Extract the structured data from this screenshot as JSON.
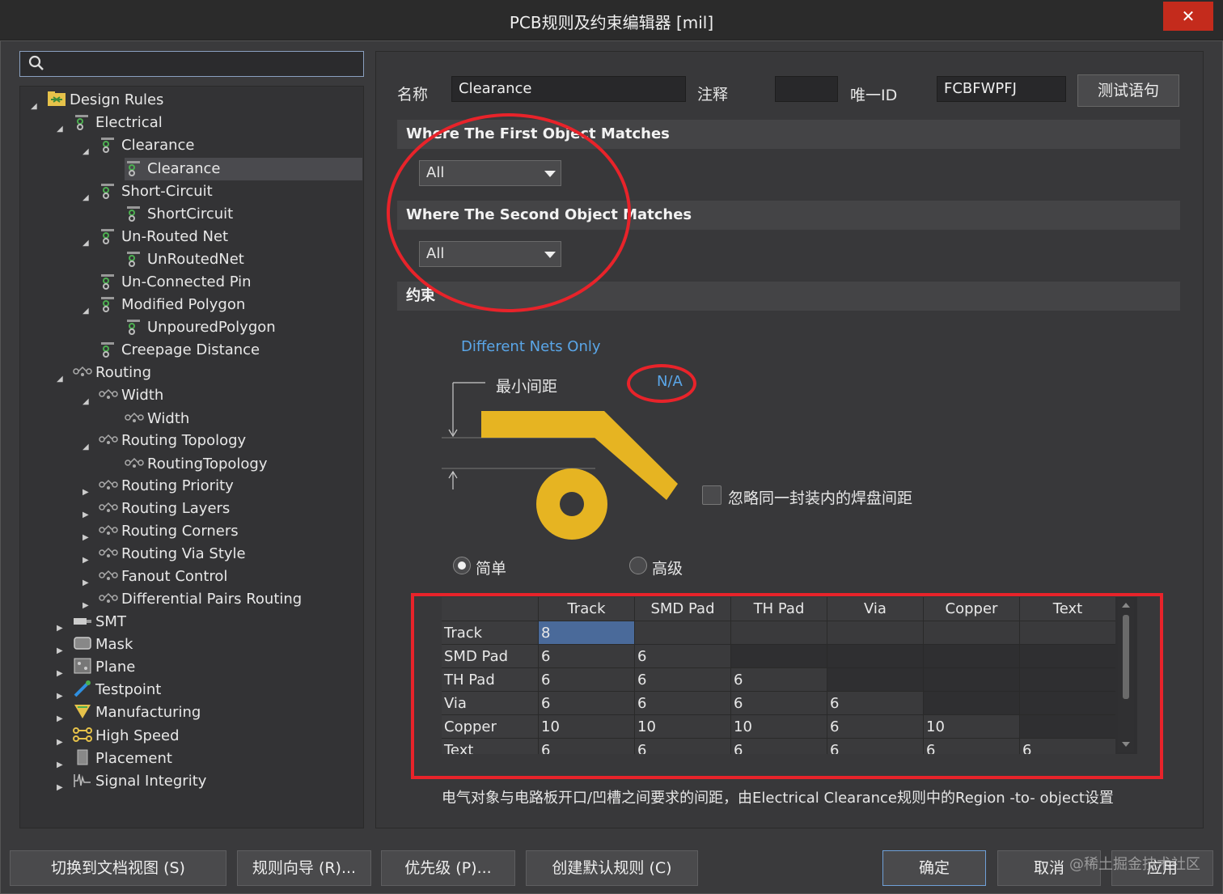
{
  "window": {
    "title": "PCB规则及约束编辑器 [mil]",
    "close": "✕"
  },
  "search": {
    "placeholder": ""
  },
  "tree": [
    {
      "label": "Design Rules"
    },
    {
      "label": "Electrical"
    },
    {
      "label": "Clearance"
    },
    {
      "label": "Clearance"
    },
    {
      "label": "Short-Circuit"
    },
    {
      "label": "ShortCircuit"
    },
    {
      "label": "Un-Routed Net"
    },
    {
      "label": "UnRoutedNet"
    },
    {
      "label": "Un-Connected Pin"
    },
    {
      "label": "Modified Polygon"
    },
    {
      "label": "UnpouredPolygon"
    },
    {
      "label": "Creepage Distance"
    },
    {
      "label": "Routing"
    },
    {
      "label": "Width"
    },
    {
      "label": "Width"
    },
    {
      "label": "Routing Topology"
    },
    {
      "label": "RoutingTopology"
    },
    {
      "label": "Routing Priority"
    },
    {
      "label": "Routing Layers"
    },
    {
      "label": "Routing Corners"
    },
    {
      "label": "Routing Via Style"
    },
    {
      "label": "Fanout Control"
    },
    {
      "label": "Differential Pairs Routing"
    },
    {
      "label": "SMT"
    },
    {
      "label": "Mask"
    },
    {
      "label": "Plane"
    },
    {
      "label": "Testpoint"
    },
    {
      "label": "Manufacturing"
    },
    {
      "label": "High Speed"
    },
    {
      "label": "Placement"
    },
    {
      "label": "Signal Integrity"
    }
  ],
  "rule": {
    "name_label": "名称",
    "name_value": "Clearance",
    "comment_label": "注释",
    "comment_value": "",
    "id_label": "唯一ID",
    "id_value": "FCBFWPFJ",
    "test_button": "测试语句"
  },
  "first_match": {
    "title": "Where The First Object Matches",
    "value": "All"
  },
  "second_match": {
    "title": "Where The Second Object Matches",
    "value": "All"
  },
  "constraints": {
    "title": "约束",
    "net_scope": "Different Nets Only",
    "min_clearance_label": "最小间距",
    "min_clearance_value": "N/A",
    "ignore_pad_label": "忽略同一封装内的焊盘间距",
    "mode_simple": "简单",
    "mode_advanced": "高级",
    "mode_selected": "简单"
  },
  "matrix": {
    "columns": [
      "Track",
      "SMD Pad",
      "TH Pad",
      "Via",
      "Copper",
      "Text"
    ],
    "rows": [
      {
        "name": "Track",
        "values": [
          "8",
          "",
          "",
          "",
          "",
          ""
        ]
      },
      {
        "name": "SMD Pad",
        "values": [
          "6",
          "6",
          "",
          "",
          "",
          ""
        ]
      },
      {
        "name": "TH Pad",
        "values": [
          "6",
          "6",
          "6",
          "",
          "",
          ""
        ]
      },
      {
        "name": "Via",
        "values": [
          "6",
          "6",
          "6",
          "6",
          "",
          ""
        ]
      },
      {
        "name": "Copper",
        "values": [
          "10",
          "10",
          "10",
          "6",
          "10",
          ""
        ]
      },
      {
        "name": "Text",
        "values": [
          "6",
          "6",
          "6",
          "6",
          "6",
          "6"
        ]
      }
    ]
  },
  "note": "电气对象与电路板开口/凹槽之间要求的间距，由Electrical Clearance规则中的Region -to- object设置",
  "footer": {
    "doc_view": "切换到文档视图 (S)",
    "rule_wizard": "规则向导 (R)...",
    "priority": "优先级 (P)...",
    "create_default": "创建默认规则 (C)",
    "ok": "确定",
    "cancel": "取消",
    "apply": "应用"
  },
  "watermark": "@稀土掘金技术社区",
  "colors": {
    "accent_red": "#e8232a",
    "track_yellow": "#e6b422",
    "link_blue": "#5aa6e8"
  }
}
